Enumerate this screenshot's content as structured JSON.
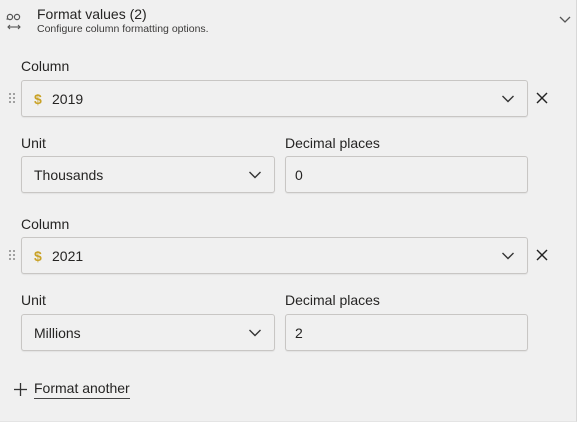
{
  "header": {
    "title": "Format values (2)",
    "subtitle": "Configure column formatting options.",
    "icon": "format-values-icon"
  },
  "rules": [
    {
      "column_label": "Column",
      "column_value": "2019",
      "column_type_symbol": "$",
      "unit_label": "Unit",
      "unit_value": "Thousands",
      "decimal_label": "Decimal places",
      "decimal_value": "0"
    },
    {
      "column_label": "Column",
      "column_value": "2021",
      "column_type_symbol": "$",
      "unit_label": "Unit",
      "unit_value": "Millions",
      "decimal_label": "Decimal places",
      "decimal_value": "2"
    }
  ],
  "add_button": {
    "label": "Format another"
  },
  "colors": {
    "accent_currency": "#c9a227",
    "background": "#f0f0f0",
    "border": "#c8c6c4"
  }
}
